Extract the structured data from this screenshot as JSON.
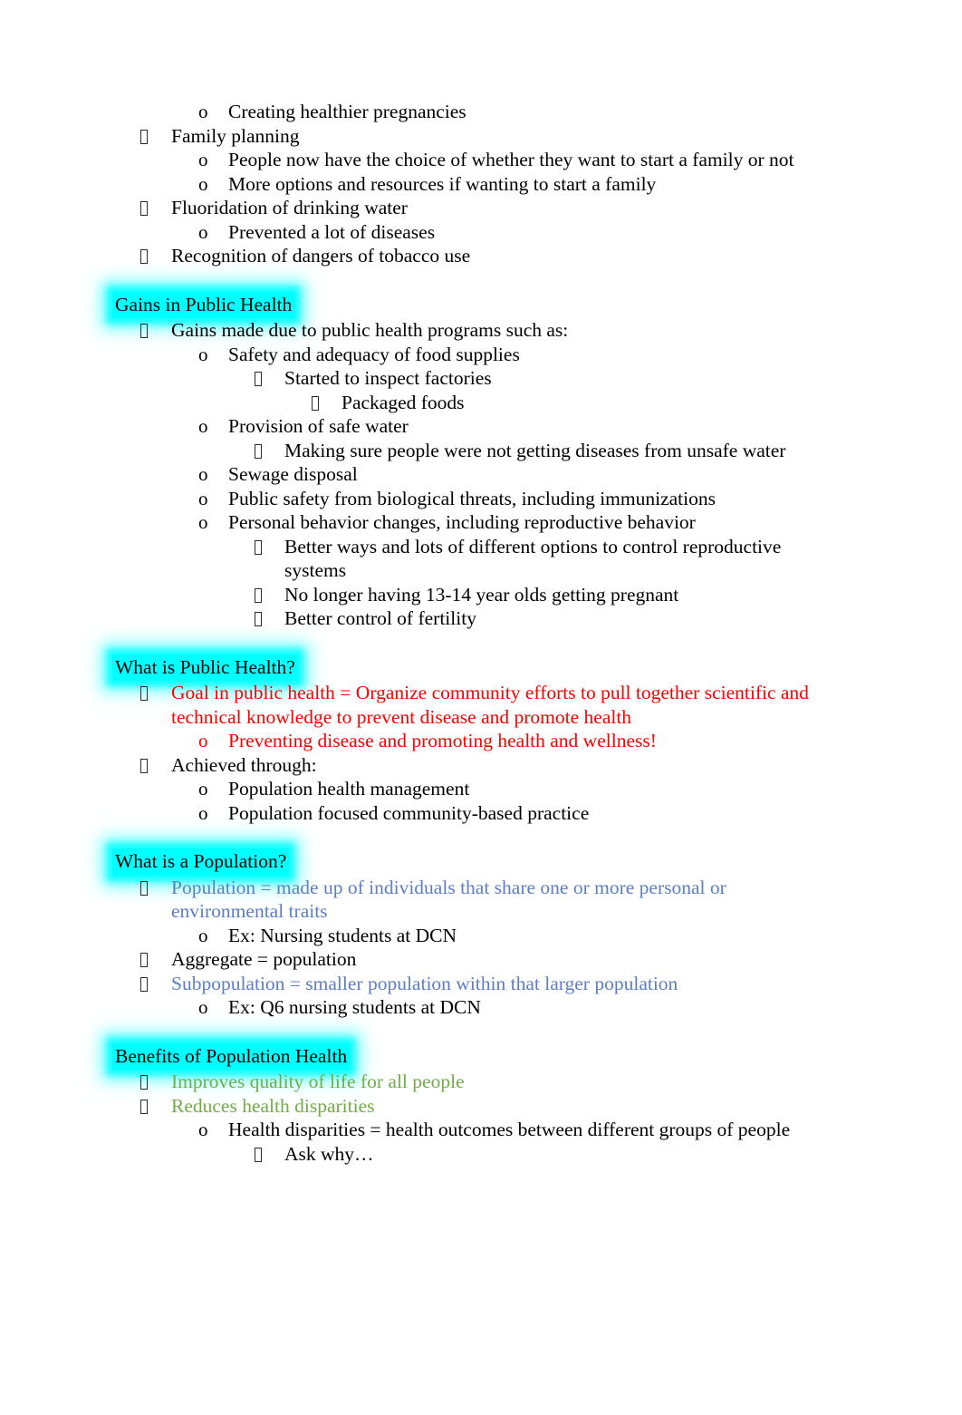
{
  "document": {
    "title": "Public Health Notes",
    "page_background": "#ffffff",
    "body_text_color": "#000000",
    "highlight_color": "#00ffff",
    "accent_colors": {
      "red": "#ff0000",
      "blue": "#5b7fc7",
      "green": "#70ad47"
    },
    "markers": {
      "level1": "tofu-box",
      "level2": "o",
      "level3": "tofu-box",
      "level4": "tofu-box"
    }
  },
  "blocks": [
    {
      "id": "intro",
      "type": "list",
      "items": [
        {
          "level": 2,
          "marker": "o",
          "text": "Creating healthier pregnancies",
          "color": "black"
        },
        {
          "level": 1,
          "marker": "tofu",
          "text": "Family planning",
          "color": "black"
        },
        {
          "level": 2,
          "marker": "o",
          "text": "People now have the choice of whether they want to start a family or not",
          "color": "black"
        },
        {
          "level": 2,
          "marker": "o",
          "text": "More options and resources if wanting to start a family",
          "color": "black"
        },
        {
          "level": 1,
          "marker": "tofu",
          "text": "Fluoridation of drinking water",
          "color": "black"
        },
        {
          "level": 2,
          "marker": "o",
          "text": "Prevented a lot of diseases",
          "color": "black"
        },
        {
          "level": 1,
          "marker": "tofu",
          "text": "Recognition of dangers of tobacco use",
          "color": "black"
        }
      ]
    },
    {
      "id": "gains",
      "type": "section",
      "heading": "Gains in Public Health",
      "heading_highlight": "#00ffff",
      "items": [
        {
          "level": 1,
          "marker": "tofu",
          "text": "Gains made due to public health programs such as:",
          "color": "black"
        },
        {
          "level": 2,
          "marker": "o",
          "text": "Safety and adequacy of food supplies",
          "color": "black"
        },
        {
          "level": 3,
          "marker": "tofu",
          "text": "Started to inspect factories",
          "color": "black"
        },
        {
          "level": 4,
          "marker": "tofu",
          "text": "Packaged foods",
          "color": "black"
        },
        {
          "level": 2,
          "marker": "o",
          "text": "Provision of safe water",
          "color": "black"
        },
        {
          "level": 3,
          "marker": "tofu",
          "text": "Making sure people were not getting diseases from unsafe water",
          "color": "black"
        },
        {
          "level": 2,
          "marker": "o",
          "text": "Sewage disposal",
          "color": "black"
        },
        {
          "level": 2,
          "marker": "o",
          "text": "Public safety from biological threats, including immunizations",
          "color": "black"
        },
        {
          "level": 2,
          "marker": "o",
          "text": "Personal behavior changes, including reproductive behavior",
          "color": "black"
        },
        {
          "level": 3,
          "marker": "tofu",
          "text": "Better ways and lots of different options to control reproductive systems",
          "color": "black"
        },
        {
          "level": 3,
          "marker": "tofu",
          "text": "No longer having 13-14 year olds getting pregnant",
          "color": "black"
        },
        {
          "level": 3,
          "marker": "tofu",
          "text": "Better control of fertility",
          "color": "black"
        }
      ]
    },
    {
      "id": "what-is-public-health",
      "type": "section",
      "heading": "What is Public Health?",
      "heading_highlight": "#00ffff",
      "items": [
        {
          "level": 1,
          "marker": "tofu",
          "text": "Goal in public health = Organize community efforts to pull together scientific and technical knowledge to prevent disease and promote health",
          "color": "red"
        },
        {
          "level": 2,
          "marker": "o",
          "text": "Preventing disease and promoting health and wellness!",
          "color": "red"
        },
        {
          "level": 1,
          "marker": "tofu",
          "text": "Achieved through:",
          "color": "black"
        },
        {
          "level": 2,
          "marker": "o",
          "text": "Population health management",
          "color": "black"
        },
        {
          "level": 2,
          "marker": "o",
          "text": "Population focused community-based practice",
          "color": "black"
        }
      ]
    },
    {
      "id": "what-is-a-population",
      "type": "section",
      "heading": "What is a Population?",
      "heading_highlight": "#00ffff",
      "items": [
        {
          "level": 1,
          "marker": "tofu",
          "text": "Population = made up of individuals that share one or more personal or environmental traits",
          "color": "blue"
        },
        {
          "level": 2,
          "marker": "o",
          "text": "Ex: Nursing students at DCN",
          "color": "black"
        },
        {
          "level": 1,
          "marker": "tofu",
          "text": "Aggregate = population",
          "color": "black"
        },
        {
          "level": 1,
          "marker": "tofu",
          "text": "Subpopulation = smaller population within that larger population",
          "color": "blue"
        },
        {
          "level": 2,
          "marker": "o",
          "text": "Ex: Q6 nursing students at DCN",
          "color": "black"
        }
      ]
    },
    {
      "id": "benefits-of-population-health",
      "type": "section",
      "heading": "Benefits of Population Health",
      "heading_highlight": "#00ffff",
      "items": [
        {
          "level": 1,
          "marker": "tofu",
          "text": "Improves quality of life for all people",
          "color": "green"
        },
        {
          "level": 1,
          "marker": "tofu",
          "text": "Reduces health disparities",
          "color": "green"
        },
        {
          "level": 2,
          "marker": "o",
          "text": "Health disparities = health outcomes between different groups of people",
          "color": "black"
        },
        {
          "level": 3,
          "marker": "tofu",
          "text": "Ask why…",
          "color": "black"
        }
      ]
    }
  ]
}
